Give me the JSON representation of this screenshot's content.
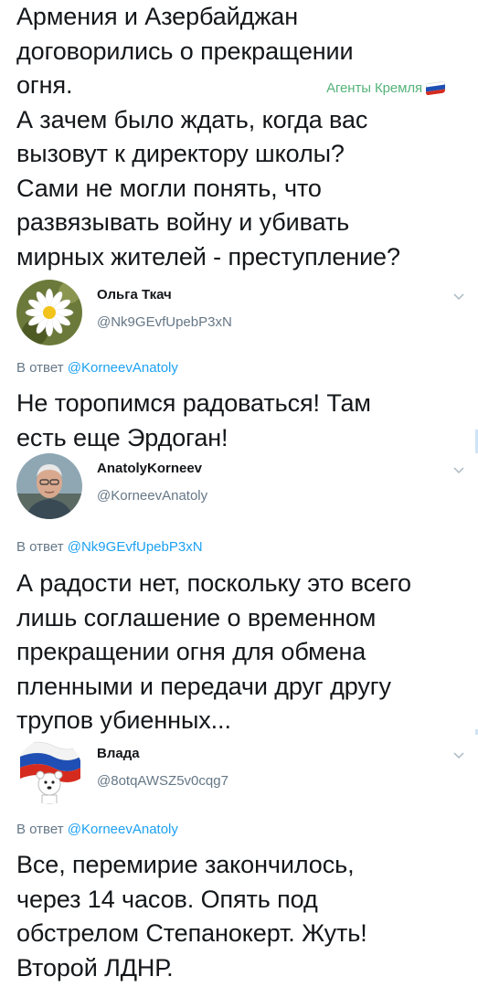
{
  "tweet1": {
    "line1": "Армения и Азербайджан",
    "line2": "договорились о прекращении",
    "line3": "огня.",
    "agents_label": "Агенты Кремля",
    "line4": "А зачем было ждать, когда вас",
    "line5": "вызовут к директору школы?",
    "line6": "Сами не могли понять, что",
    "line7": "развязывать  войну и убивать",
    "line8": "мирных жителей - преступление?"
  },
  "tweet2": {
    "name": "Ольга Ткач",
    "handle": "@Nk9GEvfUpebP3xN",
    "reply_prefix": "В ответ ",
    "reply_to": "@KorneevAnatoly",
    "line1": "Не торопимся радоваться! Там",
    "line2": "есть еще Эрдоган!"
  },
  "tweet3": {
    "name": "AnatolyKorneev",
    "handle": "@KorneevAnatoly",
    "reply_prefix": "В ответ ",
    "reply_to": "@Nk9GEvfUpebP3xN",
    "line1": "А радости нет, поскольку это всего",
    "line2": "лишь соглашение о временном",
    "line3": "прекращении огня для обмена",
    "line4": "пленными и передачи друг другу",
    "line5": "трупов убиенных..."
  },
  "tweet4": {
    "name": "Влада",
    "handle": "@8otqAWSZ5v0cqg7",
    "reply_prefix": "В ответ ",
    "reply_to": "@KorneevAnatoly",
    "line1": "Все, перемирие закончилось,",
    "line2": "через 14 часов. Опять под",
    "line3": "обстрелом Степанокерт. Жуть!",
    "line4": "Второй ЛДНР."
  },
  "icons": [
    "chevron-down-icon",
    "russia-flag-icon",
    "daisy-avatar",
    "man-avatar",
    "flag-bear-avatar"
  ],
  "colors": {
    "text": "#14171a",
    "muted": "#657786",
    "link": "#1da1f2",
    "agents": "#55b37a"
  }
}
